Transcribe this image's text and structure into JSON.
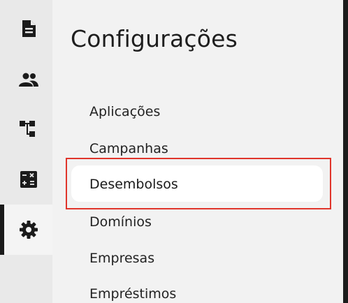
{
  "page": {
    "title": "Configurações"
  },
  "sidebar": {
    "items": [
      {
        "icon": "document-icon",
        "label": ""
      },
      {
        "icon": "people-icon",
        "label": ""
      },
      {
        "icon": "hierarchy-icon",
        "label": ""
      },
      {
        "icon": "calculator-icon",
        "label": ""
      },
      {
        "icon": "gear-icon",
        "label": "",
        "active": true
      }
    ]
  },
  "menu": {
    "items": [
      "Aplicações",
      "Campanhas",
      "Desembolsos",
      "Domínios",
      "Empresas",
      "Empréstimos"
    ],
    "selected_index": 2
  },
  "colors": {
    "highlight_outline": "#e0352b",
    "rail_background": "#e9e9e9",
    "content_background": "#f2f2f2",
    "selected_background": "#ffffff"
  }
}
